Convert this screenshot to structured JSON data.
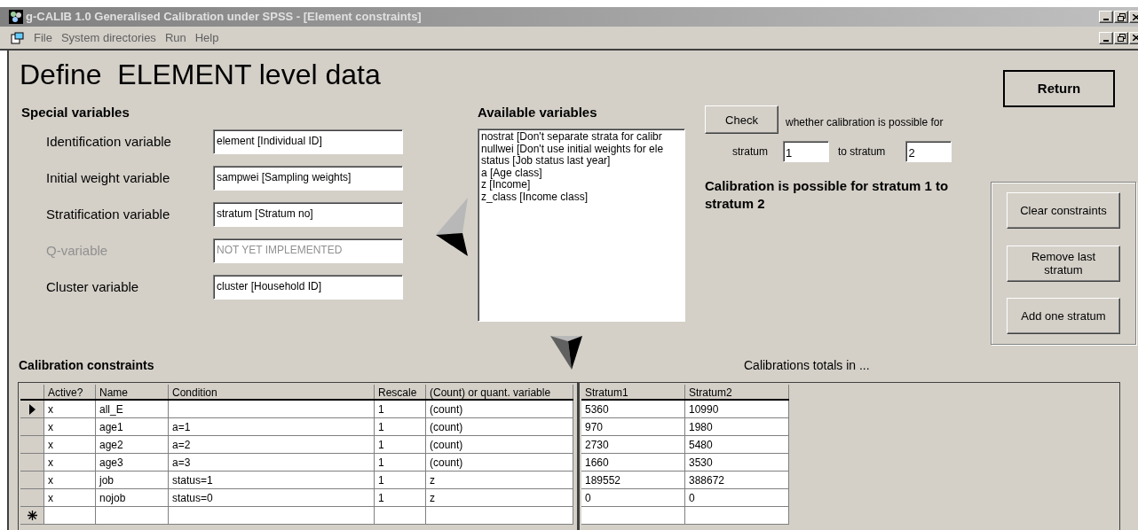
{
  "window": {
    "title": "g-CALIB 1.0 Generalised Calibration under SPSS - [Element constraints]"
  },
  "menu": {
    "items": [
      "File",
      "System directories",
      "Run",
      "Help"
    ]
  },
  "heading": "Define  ELEMENT level data",
  "return_button": "Return",
  "special_variables": {
    "title": "Special variables",
    "fields": [
      {
        "label": "Identification variable",
        "value": "element [Individual ID]",
        "disabled": false
      },
      {
        "label": "Initial weight variable",
        "value": "sampwei [Sampling weights]",
        "disabled": false
      },
      {
        "label": "Stratification variable",
        "value": "stratum [Stratum no]",
        "disabled": false
      },
      {
        "label": "Q-variable",
        "value": "NOT YET IMPLEMENTED",
        "disabled": true
      },
      {
        "label": "Cluster variable",
        "value": "cluster [Household ID]",
        "disabled": false
      }
    ]
  },
  "available_variables": {
    "title": "Available variables",
    "items": [
      "nostrat [Don't separate strata for calibr",
      "nullwei [Don't use initial weights for ele",
      "status [Job status last year]",
      "a [Age class]",
      "z [Income]",
      "z_class [Income class]"
    ]
  },
  "check": {
    "button": "Check",
    "text": "whether calibration is possible for",
    "from_label": "stratum",
    "from_value": "1",
    "to_label": "to stratum",
    "to_value": "2",
    "result": "Calibration is possible for stratum 1 to stratum 2"
  },
  "side_buttons": [
    "Clear constraints",
    "Remove last stratum",
    "Add one stratum"
  ],
  "constraints": {
    "title": "Calibration constraints",
    "columns": [
      "Active?",
      "Name",
      "Condition",
      "Rescale",
      "(Count) or quant. variable"
    ],
    "rows": [
      {
        "selected": true,
        "cells": [
          "x",
          "all_E",
          "",
          "1",
          "(count)"
        ]
      },
      {
        "selected": false,
        "cells": [
          "x",
          "age1",
          "a=1",
          "1",
          "(count)"
        ]
      },
      {
        "selected": false,
        "cells": [
          "x",
          "age2",
          "a=2",
          "1",
          "(count)"
        ]
      },
      {
        "selected": false,
        "cells": [
          "x",
          "age3",
          "a=3",
          "1",
          "(count)"
        ]
      },
      {
        "selected": false,
        "cells": [
          "x",
          "job",
          "status=1",
          "1",
          "z"
        ]
      },
      {
        "selected": false,
        "cells": [
          "x",
          "nojob",
          "status=0",
          "1",
          "z"
        ]
      }
    ]
  },
  "totals": {
    "title": "Calibrations totals in ...",
    "columns": [
      "Stratum1",
      "Stratum2"
    ],
    "rows": [
      [
        "5360",
        "10990"
      ],
      [
        "970",
        "1980"
      ],
      [
        "2730",
        "5480"
      ],
      [
        "1660",
        "3530"
      ],
      [
        "189552",
        "388672"
      ],
      [
        "0",
        "0"
      ]
    ]
  }
}
